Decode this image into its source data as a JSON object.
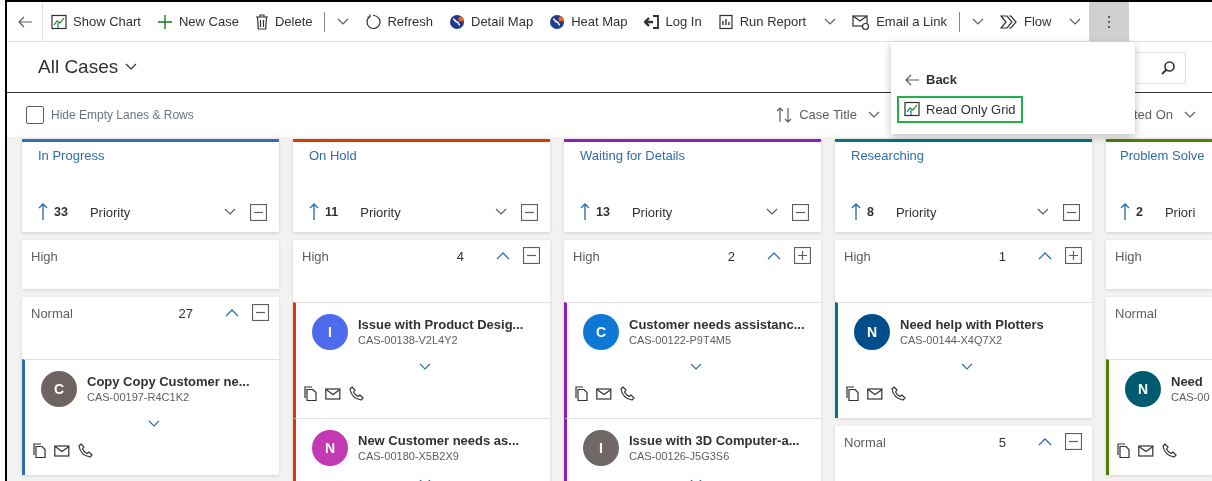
{
  "toolbar": {
    "items": [
      {
        "label": "Show Chart",
        "dropdown": false
      },
      {
        "label": "New Case",
        "dropdown": false
      },
      {
        "label": "Delete",
        "dropdown": true,
        "split": true
      },
      {
        "label": "Refresh",
        "dropdown": false
      },
      {
        "label": "Detail Map",
        "dropdown": false
      },
      {
        "label": "Heat Map",
        "dropdown": false
      },
      {
        "label": "Log In",
        "dropdown": false
      },
      {
        "label": "Run Report",
        "dropdown": true,
        "split": false
      },
      {
        "label": "Email a Link",
        "dropdown": true,
        "split": true
      },
      {
        "label": "Flow",
        "dropdown": true,
        "split": false
      }
    ],
    "more_expanded": true
  },
  "view": {
    "title": "All Cases"
  },
  "filters": {
    "hide_empty": {
      "label": "Hide Empty Lanes & Rows",
      "checked": false
    },
    "sort": {
      "label": "Case Title"
    },
    "sort_2": {
      "label": "ted On"
    }
  },
  "overflow_menu": {
    "items": [
      {
        "label": "Back",
        "kind": "back",
        "highlighted": false
      },
      {
        "label": "Read Only Grid",
        "kind": "command",
        "highlighted": true
      }
    ]
  },
  "lanes": [
    {
      "title": "In Progress",
      "color": "#2f6fb5",
      "count": "33",
      "sort_label": "Priority",
      "clipped": false,
      "groups": [
        {
          "label": "High"
        },
        {
          "label": "Normal",
          "count": "27",
          "collapsed": false,
          "cards": [
            {
              "initial": "C",
              "color": "#6e6461",
              "title": "Copy Copy Customer ne...",
              "number": "CAS-00197-R4C1K2"
            }
          ]
        }
      ]
    },
    {
      "title": "On Hold",
      "color": "#d83b01",
      "count": "11",
      "sort_label": "Priority",
      "clipped": false,
      "groups": [
        {
          "label": "High",
          "count": "4",
          "collapsed": false,
          "cards": [
            {
              "initial": "I",
              "color": "#4f6bed",
              "title": "Issue with Product Desig...",
              "number": "CAS-00138-V2L4Y2"
            },
            {
              "initial": "N",
              "color": "#c239b3",
              "title": "New Customer needs as...",
              "number": "CAS-00180-X5B2X9"
            }
          ]
        }
      ]
    },
    {
      "title": "Waiting for Details",
      "color": "#8c1fbf",
      "count": "13",
      "sort_label": "Priority",
      "clipped": false,
      "groups": [
        {
          "label": "High",
          "count": "2",
          "collapsed": true,
          "cards": [
            {
              "initial": "C",
              "color": "#0f78d4",
              "title": "Customer needs assistanc...",
              "number": "CAS-00122-P9T4M5"
            },
            {
              "initial": "I",
              "color": "#6f6867",
              "title": "Issue with 3D Computer-a...",
              "number": "CAS-00126-J5G3S6"
            }
          ]
        }
      ]
    },
    {
      "title": "Researching",
      "color": "#03787c",
      "count": "8",
      "sort_label": "Priority",
      "clipped": false,
      "groups": [
        {
          "label": "High",
          "count": "1",
          "collapsed": true,
          "cards": [
            {
              "initial": "N",
              "color": "#004e8c",
              "title": "Need help with Plotters",
              "number": "CAS-00144-X4Q7X2"
            }
          ]
        },
        {
          "label": "Normal",
          "count": "5",
          "collapsed": false
        }
      ]
    },
    {
      "title": "Problem Solve",
      "color": "#498205",
      "count": "2",
      "sort_label": "Priori",
      "clipped": true,
      "groups": [
        {
          "label": "High"
        },
        {
          "label": "Normal",
          "cards": [
            {
              "initial": "N",
              "color": "#005b70",
              "title": "Need",
              "number": "CAS-00"
            }
          ]
        }
      ]
    }
  ]
}
